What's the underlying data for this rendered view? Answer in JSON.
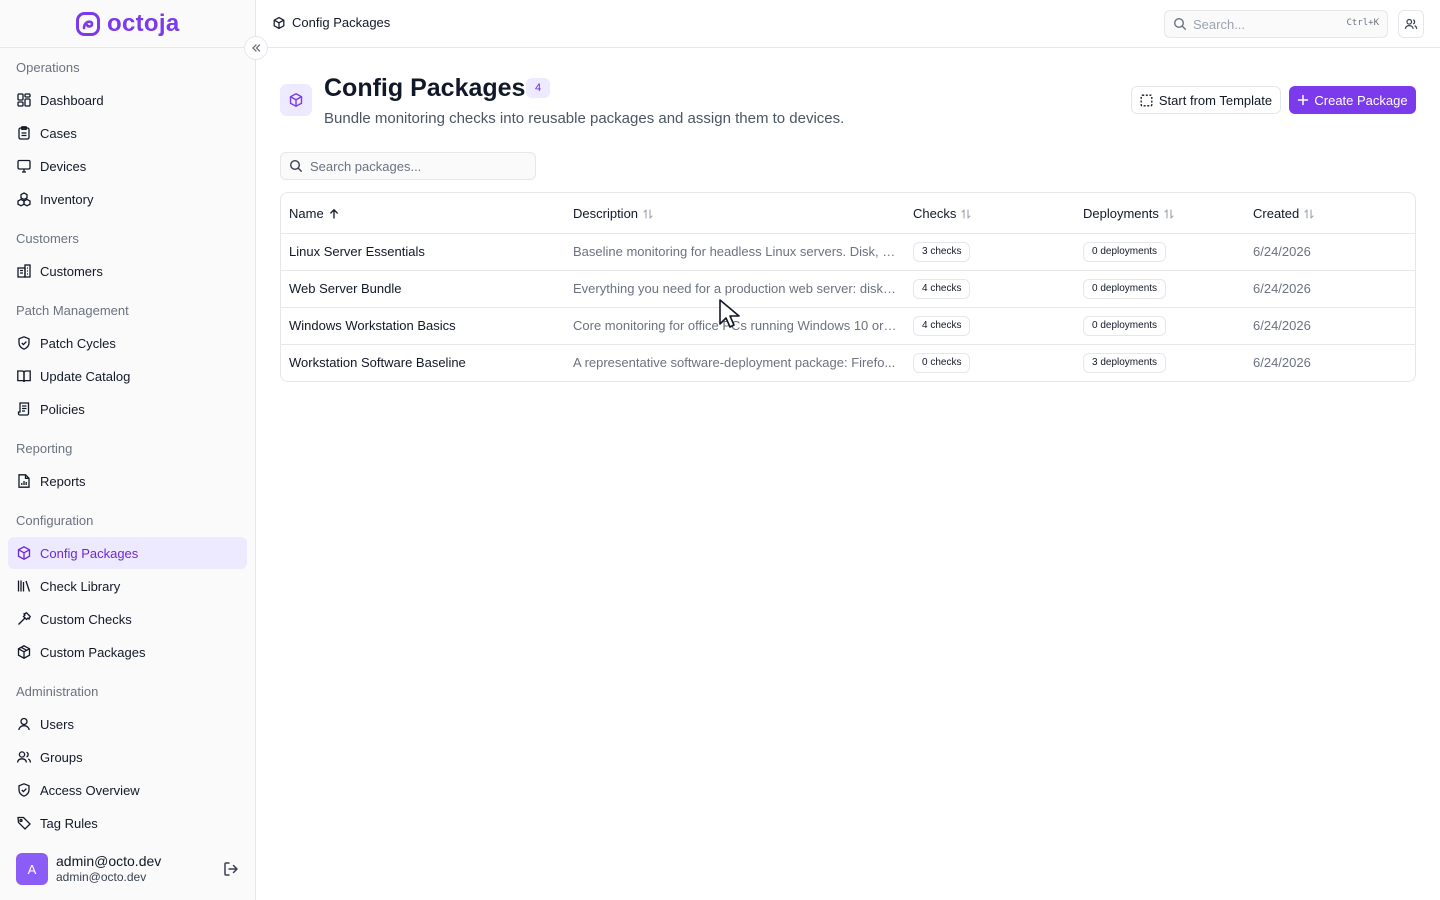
{
  "brand": {
    "name": "octoja",
    "accent": "#7c3aed"
  },
  "sidebar": {
    "sections": [
      {
        "label": "Operations",
        "items": [
          {
            "label": "Dashboard",
            "icon": "dashboard-icon"
          },
          {
            "label": "Cases",
            "icon": "clipboard-icon"
          },
          {
            "label": "Devices",
            "icon": "monitor-icon"
          },
          {
            "label": "Inventory",
            "icon": "boxes-icon"
          }
        ]
      },
      {
        "label": "Customers",
        "items": [
          {
            "label": "Customers",
            "icon": "building-icon"
          }
        ]
      },
      {
        "label": "Patch Management",
        "items": [
          {
            "label": "Patch Cycles",
            "icon": "shield-check-icon"
          },
          {
            "label": "Update Catalog",
            "icon": "book-open-icon"
          },
          {
            "label": "Policies",
            "icon": "scroll-icon"
          }
        ]
      },
      {
        "label": "Reporting",
        "items": [
          {
            "label": "Reports",
            "icon": "file-chart-icon"
          }
        ]
      },
      {
        "label": "Configuration",
        "items": [
          {
            "label": "Config Packages",
            "icon": "package-icon",
            "active": true
          },
          {
            "label": "Check Library",
            "icon": "library-icon"
          },
          {
            "label": "Custom Checks",
            "icon": "hammer-icon"
          },
          {
            "label": "Custom Packages",
            "icon": "packages-icon"
          }
        ]
      },
      {
        "label": "Administration",
        "items": [
          {
            "label": "Users",
            "icon": "user-icon"
          },
          {
            "label": "Groups",
            "icon": "users-icon"
          },
          {
            "label": "Access Overview",
            "icon": "shield-check-icon"
          },
          {
            "label": "Tag Rules",
            "icon": "tag-icon"
          }
        ]
      }
    ],
    "user": {
      "initial": "A",
      "name": "admin@octo.dev",
      "email": "admin@octo.dev"
    }
  },
  "topbar": {
    "breadcrumb": "Config Packages",
    "search_placeholder": "Search...",
    "search_shortcut": "Ctrl+K"
  },
  "header": {
    "title": "Config Packages",
    "count": "4",
    "subtitle": "Bundle monitoring checks into reusable packages and assign them to devices.",
    "template_button": "Start from Template",
    "create_button": "Create Package"
  },
  "package_search": {
    "placeholder": "Search packages..."
  },
  "table": {
    "columns": [
      {
        "label": "Name",
        "sort": "asc"
      },
      {
        "label": "Description",
        "sort": "none"
      },
      {
        "label": "Checks",
        "sort": "none"
      },
      {
        "label": "Deployments",
        "sort": "none"
      },
      {
        "label": "Created",
        "sort": "none"
      }
    ],
    "rows": [
      {
        "name": "Linux Server Essentials",
        "description": "Baseline monitoring for headless Linux servers. Disk, s...",
        "checks": "3 checks",
        "deployments": "0 deployments",
        "created": "6/24/2026"
      },
      {
        "name": "Web Server Bundle",
        "description": "Everything you need for a production web server: disk ...",
        "checks": "4 checks",
        "deployments": "0 deployments",
        "created": "6/24/2026"
      },
      {
        "name": "Windows Workstation Basics",
        "description": "Core monitoring for office PCs running Windows 10 or 1...",
        "checks": "4 checks",
        "deployments": "0 deployments",
        "created": "6/24/2026"
      },
      {
        "name": "Workstation Software Baseline",
        "description": "A representative software-deployment package: Firefo...",
        "checks": "0 checks",
        "deployments": "3 deployments",
        "created": "6/24/2026"
      }
    ]
  }
}
